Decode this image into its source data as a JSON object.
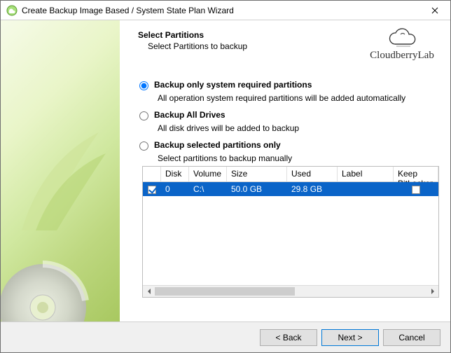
{
  "titlebar": {
    "title": "Create Backup Image Based / System State Plan Wizard"
  },
  "brand": {
    "name": "CloudberryLab"
  },
  "header": {
    "title": "Select Partitions",
    "subtitle": "Select Partitions to backup"
  },
  "options": [
    {
      "label": "Backup only system required partitions",
      "desc": "All operation system required partitions will be added automatically",
      "selected": true
    },
    {
      "label": "Backup All Drives",
      "desc": "All disk drives will be added to backup",
      "selected": false
    },
    {
      "label": "Backup selected partitions only",
      "desc": "Select partitions to backup manually",
      "selected": false
    }
  ],
  "grid": {
    "columns": {
      "chk": "",
      "disk": "Disk",
      "volume": "Volume",
      "size": "Size",
      "used": "Used",
      "label": "Label",
      "keep": "Keep BitLocker"
    },
    "rows": [
      {
        "checked": true,
        "disk": "0",
        "volume": "C:\\",
        "size": "50.0 GB",
        "used": "29.8 GB",
        "label": "",
        "keep": false,
        "selected": true
      }
    ]
  },
  "footer": {
    "back": "< Back",
    "next": "Next >",
    "cancel": "Cancel"
  }
}
